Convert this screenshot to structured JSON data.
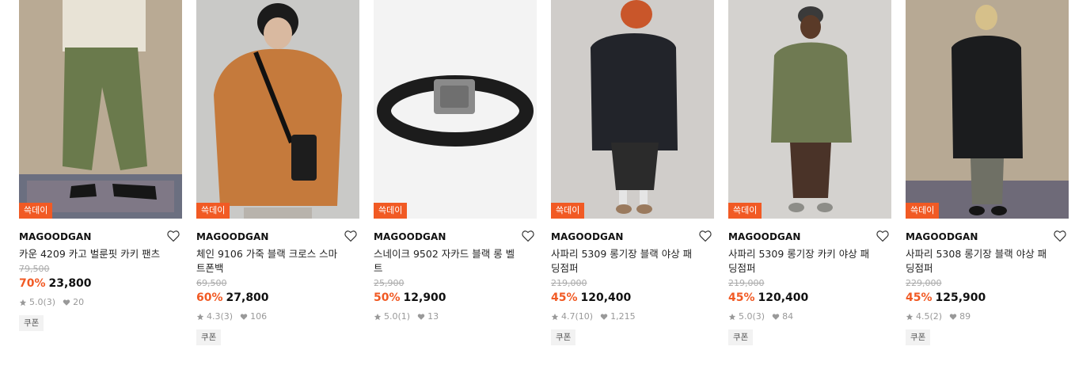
{
  "products": [
    {
      "badge": "쓱데이",
      "brand": "MAGOODGAN",
      "title": "카운 4209 카고 벌룬핏 카키 팬츠",
      "original_price": "79,500",
      "discount": "70%",
      "price": "23,800",
      "rating": "5.0",
      "reviews": "(3)",
      "likes": "20",
      "coupon": "쿠폰",
      "image": "khaki cargo pants"
    },
    {
      "badge": "쓱데이",
      "brand": "MAGOODGAN",
      "title": "체인 9106 가죽 블랙 크로스 스마트폰백",
      "original_price": "69,500",
      "discount": "60%",
      "price": "27,800",
      "rating": "4.3",
      "reviews": "(3)",
      "likes": "106",
      "coupon": "쿠폰",
      "image": "orange hoodie with cross phone bag"
    },
    {
      "badge": "쓱데이",
      "brand": "MAGOODGAN",
      "title": "스네이크 9502 자카드 블랙 롱 벨트",
      "original_price": "25,900",
      "discount": "50%",
      "price": "12,900",
      "rating": "5.0",
      "reviews": "(1)",
      "likes": "13",
      "coupon": "",
      "image": "black jacquard belt"
    },
    {
      "badge": "쓱데이",
      "brand": "MAGOODGAN",
      "title": "사파리 5309 롱기장 블랙 야상 패딩점퍼",
      "original_price": "219,000",
      "discount": "45%",
      "price": "120,400",
      "rating": "4.7",
      "reviews": "(10)",
      "likes": "1,215",
      "coupon": "쿠폰",
      "image": "black long parka"
    },
    {
      "badge": "쓱데이",
      "brand": "MAGOODGAN",
      "title": "사파리 5309 롱기장 카키 야상 패딩점퍼",
      "original_price": "219,000",
      "discount": "45%",
      "price": "120,400",
      "rating": "5.0",
      "reviews": "(3)",
      "likes": "84",
      "coupon": "쿠폰",
      "image": "khaki long parka"
    },
    {
      "badge": "쓱데이",
      "brand": "MAGOODGAN",
      "title": "사파리 5308 롱기장 블랙 야상 패딩점퍼",
      "original_price": "229,000",
      "discount": "45%",
      "price": "125,900",
      "rating": "4.5",
      "reviews": "(2)",
      "likes": "89",
      "coupon": "쿠폰",
      "image": "black long padded parka"
    }
  ]
}
